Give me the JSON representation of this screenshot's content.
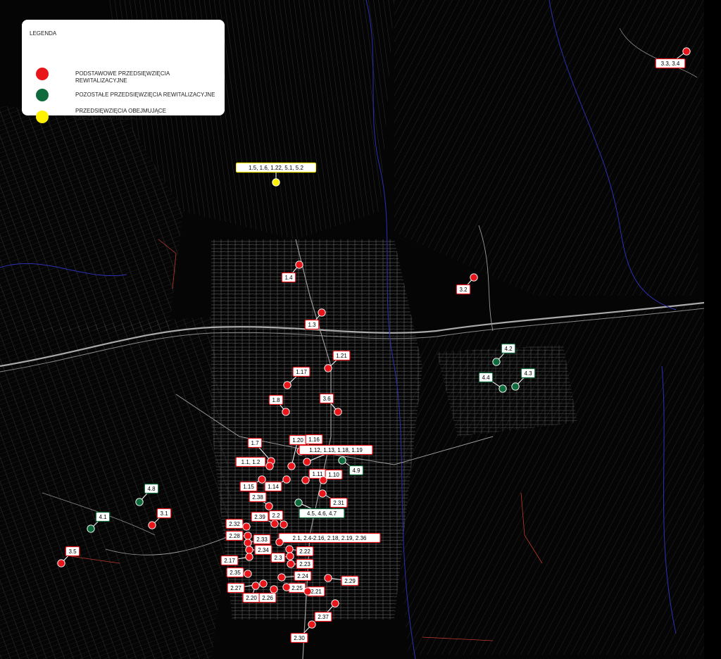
{
  "legend": {
    "title": "LEGENDA",
    "items": [
      {
        "text": "PODSTAWOWE PRZEDSIĘWZIĘCIA REWITALIZACYJNE",
        "color": "#e8161b",
        "icon": "red-dot-icon"
      },
      {
        "text": "POZOSTAŁE PRZEDSIĘWZIĘCIA REWITALIZACYJNE",
        "color": "#0f6b3c",
        "icon": "green-dot-icon"
      },
      {
        "text": "PRZEDSIĘWZIĘCIA OBEJMUJĄCE\nOBSZAR REWITALIZACJI",
        "color": "#fff200",
        "icon": "yellow-dot-icon"
      }
    ]
  },
  "colors": {
    "basic": "#e8161b",
    "other": "#0f6b3c",
    "area": "#fff200",
    "background": "#050505",
    "lines": "#8a8a8a",
    "water": "#3b3cc8"
  },
  "markers": [
    {
      "label": "3.3, 3.4",
      "type": "basic"
    },
    {
      "label": "1.5, 1.6, 1.22, 5.1, 5.2",
      "type": "area"
    },
    {
      "label": "1.4",
      "type": "basic"
    },
    {
      "label": "3.2",
      "type": "basic"
    },
    {
      "label": "1.3",
      "type": "basic"
    },
    {
      "label": "1.21",
      "type": "basic"
    },
    {
      "label": "1.17",
      "type": "basic"
    },
    {
      "label": "4.2",
      "type": "other"
    },
    {
      "label": "4.3",
      "type": "other"
    },
    {
      "label": "4.4",
      "type": "other"
    },
    {
      "label": "1.8",
      "type": "basic"
    },
    {
      "label": "3.6",
      "type": "basic"
    },
    {
      "label": "1.7",
      "type": "basic"
    },
    {
      "label": "1.20",
      "type": "basic"
    },
    {
      "label": "1.16",
      "type": "basic"
    },
    {
      "label": "1.12, 1.13, 1.18, 1.19",
      "type": "basic"
    },
    {
      "label": "1.1, 1.2",
      "type": "basic"
    },
    {
      "label": "4.9",
      "type": "other"
    },
    {
      "label": "1.11",
      "type": "basic"
    },
    {
      "label": "1.10",
      "type": "basic"
    },
    {
      "label": "1.15",
      "type": "basic"
    },
    {
      "label": "1.14",
      "type": "basic"
    },
    {
      "label": "4.8",
      "type": "other"
    },
    {
      "label": "2.38",
      "type": "basic"
    },
    {
      "label": "2.31",
      "type": "basic"
    },
    {
      "label": "4.5, 4.6, 4.7",
      "type": "other"
    },
    {
      "label": "3.1",
      "type": "basic"
    },
    {
      "label": "4.1",
      "type": "other"
    },
    {
      "label": "2.39",
      "type": "basic"
    },
    {
      "label": "2.2",
      "type": "basic"
    },
    {
      "label": "2.32",
      "type": "basic"
    },
    {
      "label": "2.28",
      "type": "basic"
    },
    {
      "label": "2.33",
      "type": "basic"
    },
    {
      "label": "2.1, 2.4-2.16, 2.18, 2.19, 2.36",
      "type": "basic"
    },
    {
      "label": "2.34",
      "type": "basic"
    },
    {
      "label": "2.22",
      "type": "basic"
    },
    {
      "label": "3.5",
      "type": "basic"
    },
    {
      "label": "2.17",
      "type": "basic"
    },
    {
      "label": "2.3",
      "type": "basic"
    },
    {
      "label": "2.23",
      "type": "basic"
    },
    {
      "label": "2.35",
      "type": "basic"
    },
    {
      "label": "2.24",
      "type": "basic"
    },
    {
      "label": "2.29",
      "type": "basic"
    },
    {
      "label": "2.27",
      "type": "basic"
    },
    {
      "label": "2.25",
      "type": "basic"
    },
    {
      "label": "2.21",
      "type": "basic"
    },
    {
      "label": "2.20",
      "type": "basic"
    },
    {
      "label": "2.26",
      "type": "basic"
    },
    {
      "label": "2.37",
      "type": "basic"
    },
    {
      "label": "2.30",
      "type": "basic"
    }
  ]
}
